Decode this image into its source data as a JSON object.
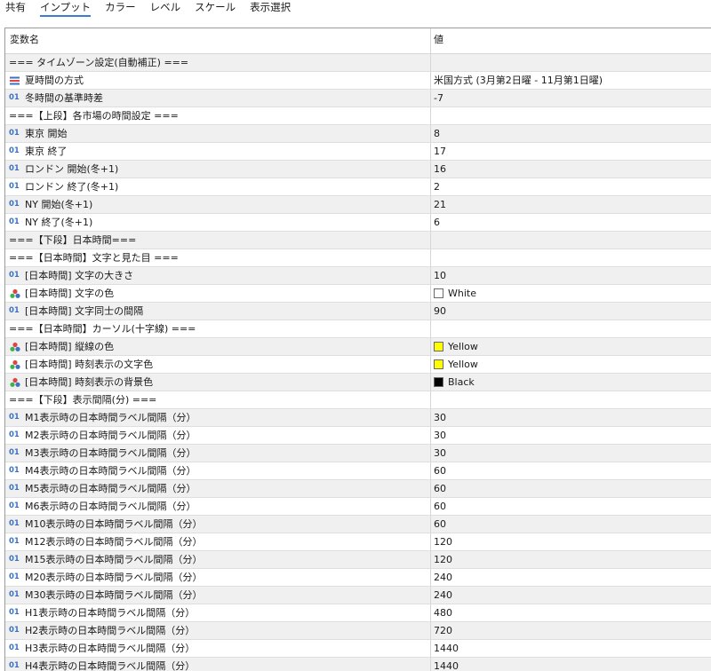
{
  "tabs": [
    "共有",
    "インプット",
    "カラー",
    "レベル",
    "スケール",
    "表示選択"
  ],
  "active_tab": 1,
  "header": {
    "name_col": "変数名",
    "value_col": "値"
  },
  "rows": [
    {
      "type": "sep",
      "name": "=== タイムゾーン設定(自動補正) ===",
      "value": ""
    },
    {
      "type": "enum",
      "name": "夏時間の方式",
      "value": "米国方式 (3月第2日曜 - 11月第1日曜)"
    },
    {
      "type": "num",
      "name": "冬時間の基準時差",
      "value": "-7"
    },
    {
      "type": "sep",
      "name": "===【上段】各市場の時間設定 ===",
      "value": ""
    },
    {
      "type": "num",
      "name": "東京 開始",
      "value": "8"
    },
    {
      "type": "num",
      "name": "東京 終了",
      "value": "17"
    },
    {
      "type": "num",
      "name": "ロンドン 開始(冬+1)",
      "value": "16"
    },
    {
      "type": "num",
      "name": "ロンドン 終了(冬+1)",
      "value": "2"
    },
    {
      "type": "num",
      "name": "NY 開始(冬+1)",
      "value": "21"
    },
    {
      "type": "num",
      "name": "NY 終了(冬+1)",
      "value": "6"
    },
    {
      "type": "sep",
      "name": "===【下段】日本時間===",
      "value": ""
    },
    {
      "type": "sep",
      "name": "===【日本時間】文字と見た目 ===",
      "value": ""
    },
    {
      "type": "num",
      "name": "[日本時間] 文字の大きさ",
      "value": "10"
    },
    {
      "type": "color",
      "name": "[日本時間] 文字の色",
      "value": "White",
      "color": "#ffffff"
    },
    {
      "type": "num",
      "name": "[日本時間] 文字同士の間隔",
      "value": "90"
    },
    {
      "type": "sep",
      "name": "===【日本時間】カーソル(十字線) ===",
      "value": ""
    },
    {
      "type": "color",
      "name": "[日本時間] 縦線の色",
      "value": "Yellow",
      "color": "#ffff00"
    },
    {
      "type": "color",
      "name": "[日本時間] 時刻表示の文字色",
      "value": "Yellow",
      "color": "#ffff00"
    },
    {
      "type": "color",
      "name": "[日本時間] 時刻表示の背景色",
      "value": "Black",
      "color": "#000000"
    },
    {
      "type": "sep",
      "name": "===【下段】表示間隔(分) ===",
      "value": ""
    },
    {
      "type": "num",
      "name": "M1表示時の日本時間ラベル間隔（分）",
      "value": "30"
    },
    {
      "type": "num",
      "name": "M2表示時の日本時間ラベル間隔（分）",
      "value": "30"
    },
    {
      "type": "num",
      "name": "M3表示時の日本時間ラベル間隔（分）",
      "value": "30"
    },
    {
      "type": "num",
      "name": "M4表示時の日本時間ラベル間隔（分）",
      "value": "60"
    },
    {
      "type": "num",
      "name": "M5表示時の日本時間ラベル間隔（分）",
      "value": "60"
    },
    {
      "type": "num",
      "name": "M6表示時の日本時間ラベル間隔（分）",
      "value": "60"
    },
    {
      "type": "num",
      "name": "M10表示時の日本時間ラベル間隔（分）",
      "value": "60"
    },
    {
      "type": "num",
      "name": "M12表示時の日本時間ラベル間隔（分）",
      "value": "120"
    },
    {
      "type": "num",
      "name": "M15表示時の日本時間ラベル間隔（分）",
      "value": "120"
    },
    {
      "type": "num",
      "name": "M20表示時の日本時間ラベル間隔（分）",
      "value": "240"
    },
    {
      "type": "num",
      "name": "M30表示時の日本時間ラベル間隔（分）",
      "value": "240"
    },
    {
      "type": "num",
      "name": "H1表示時の日本時間ラベル間隔（分）",
      "value": "480"
    },
    {
      "type": "num",
      "name": "H2表示時の日本時間ラベル間隔（分）",
      "value": "720"
    },
    {
      "type": "num",
      "name": "H3表示時の日本時間ラベル間隔（分）",
      "value": "1440"
    },
    {
      "type": "num",
      "name": "H4表示時の日本時間ラベル間隔（分）",
      "value": "1440"
    }
  ],
  "icons": {
    "num": "01",
    "enum": "enum-icon",
    "color": "color-palette-icon"
  }
}
